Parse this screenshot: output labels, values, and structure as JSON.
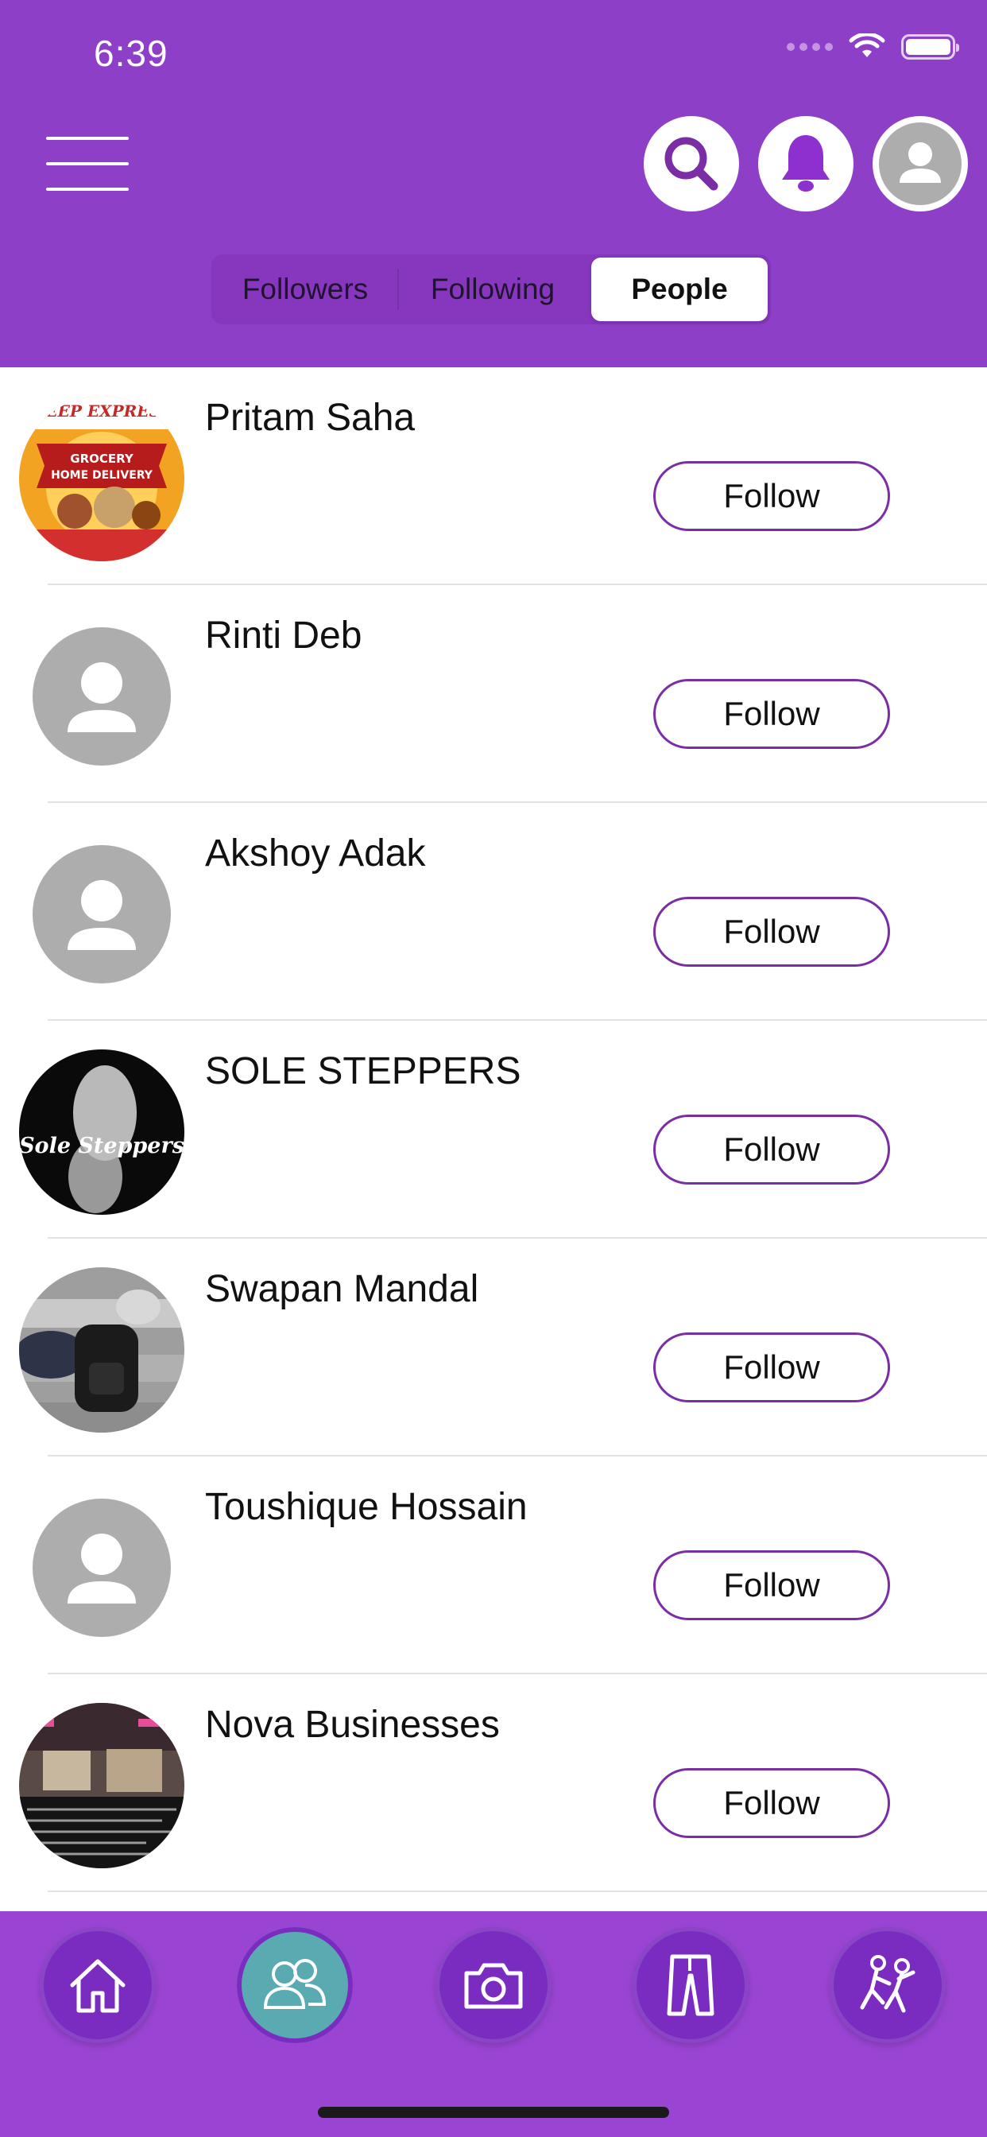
{
  "status_bar": {
    "time": "6:39"
  },
  "header": {
    "menu_icon": "hamburger-icon",
    "actions": [
      "search-icon",
      "bell-icon",
      "profile-avatar-icon"
    ],
    "tabs": [
      {
        "label": "Followers",
        "active": false
      },
      {
        "label": "Following",
        "active": false
      },
      {
        "label": "People",
        "active": true
      }
    ]
  },
  "people": [
    {
      "name": "Pritam Saha",
      "avatar": "photo",
      "button": "Follow",
      "avatar_text": [
        "DEEP EXPRESS",
        "GROCERY",
        "HOME DELIVERY"
      ]
    },
    {
      "name": "Rinti Deb",
      "avatar": "placeholder",
      "button": "Follow"
    },
    {
      "name": "Akshoy Adak",
      "avatar": "placeholder",
      "button": "Follow"
    },
    {
      "name": "SOLE STEPPERS",
      "avatar": "photo",
      "button": "Follow",
      "avatar_text": [
        "Sole Steppers"
      ]
    },
    {
      "name": "Swapan Mandal",
      "avatar": "photo",
      "button": "Follow"
    },
    {
      "name": "Toushique Hossain",
      "avatar": "placeholder",
      "button": "Follow"
    },
    {
      "name": "Nova Businesses",
      "avatar": "photo",
      "button": "Follow"
    }
  ],
  "tab_bar": {
    "items": [
      "home-icon",
      "people-icon",
      "camera-icon",
      "pants-icon",
      "dance-icon"
    ],
    "active_index": 1
  },
  "colors": {
    "brand_purple": "#8e3fc8",
    "tabbar_purple": "#9a44d4",
    "accent_teal": "#5aaab2",
    "placeholder_gray": "#adadad"
  }
}
